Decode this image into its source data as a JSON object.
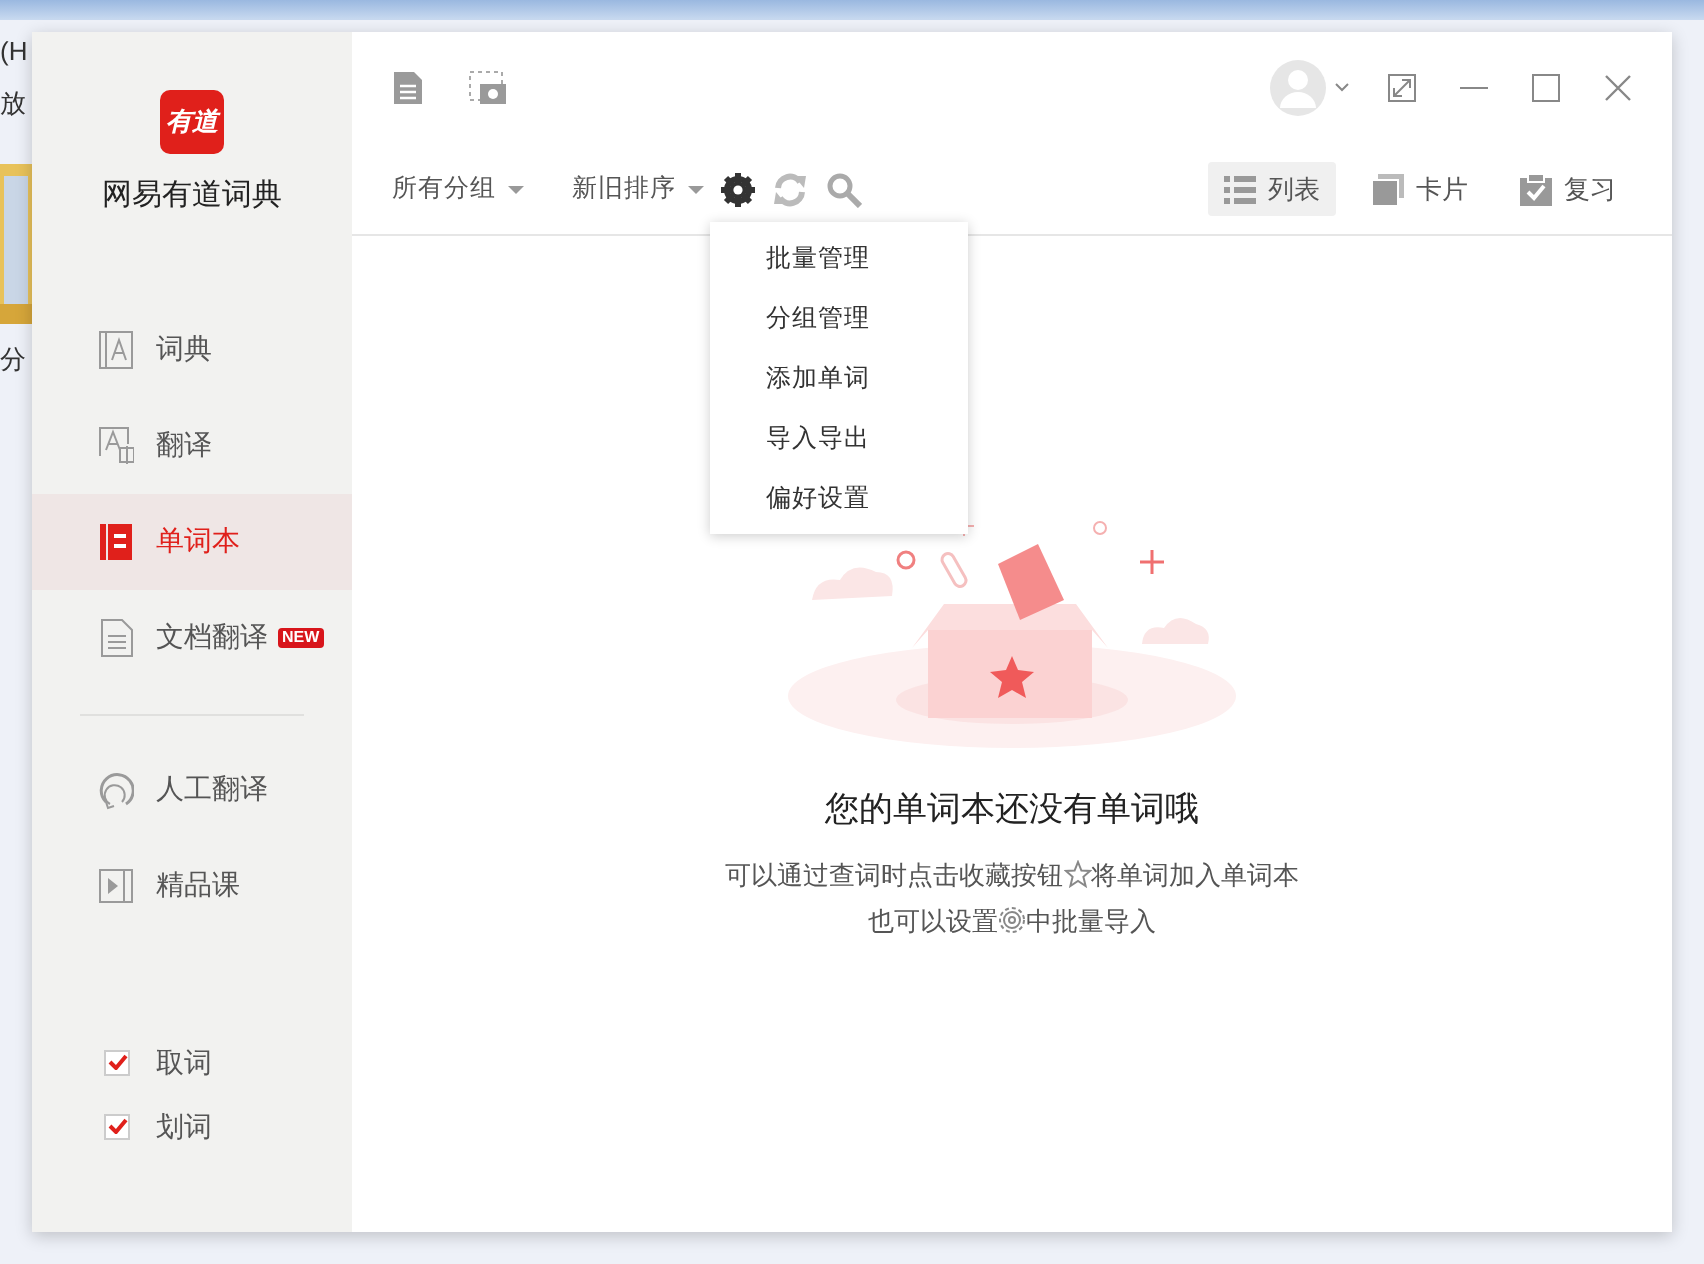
{
  "background_window": {
    "menu_text": "(H",
    "toolbar_text": "放",
    "file_label": "分"
  },
  "app": {
    "logo_text": "有道",
    "name": "网易有道词典"
  },
  "sidebar": {
    "main_items": [
      {
        "kind": "dict",
        "label": "词典",
        "selected": false
      },
      {
        "kind": "translate",
        "label": "翻译",
        "selected": false
      },
      {
        "kind": "wordbook",
        "label": "单词本",
        "selected": true
      },
      {
        "kind": "document",
        "label": "文档翻译",
        "selected": false,
        "badge": "NEW"
      }
    ],
    "service_items": [
      {
        "kind": "human",
        "label": "人工翻译",
        "selected": false
      },
      {
        "kind": "course",
        "label": "精品课",
        "selected": false
      }
    ],
    "toggles": [
      {
        "label": "取词",
        "checked": true
      },
      {
        "label": "划词",
        "checked": true
      }
    ]
  },
  "toolbar": {
    "group_filter": "所有分组",
    "sort": "新旧排序",
    "views": [
      {
        "kind": "list",
        "label": "列表",
        "selected": true
      },
      {
        "kind": "card",
        "label": "卡片",
        "selected": false
      },
      {
        "kind": "review",
        "label": "复习",
        "selected": false
      }
    ]
  },
  "menu": {
    "items": [
      "批量管理",
      "分组管理",
      "添加单词",
      "导入导出",
      "偏好设置"
    ]
  },
  "empty_state": {
    "title": "您的单词本还没有单词哦",
    "line1_before": "可以通过查词时点击收藏按钮",
    "line1_after": "将单词加入单词本",
    "line2_before": "也可以设置",
    "line2_after": "中批量导入"
  }
}
